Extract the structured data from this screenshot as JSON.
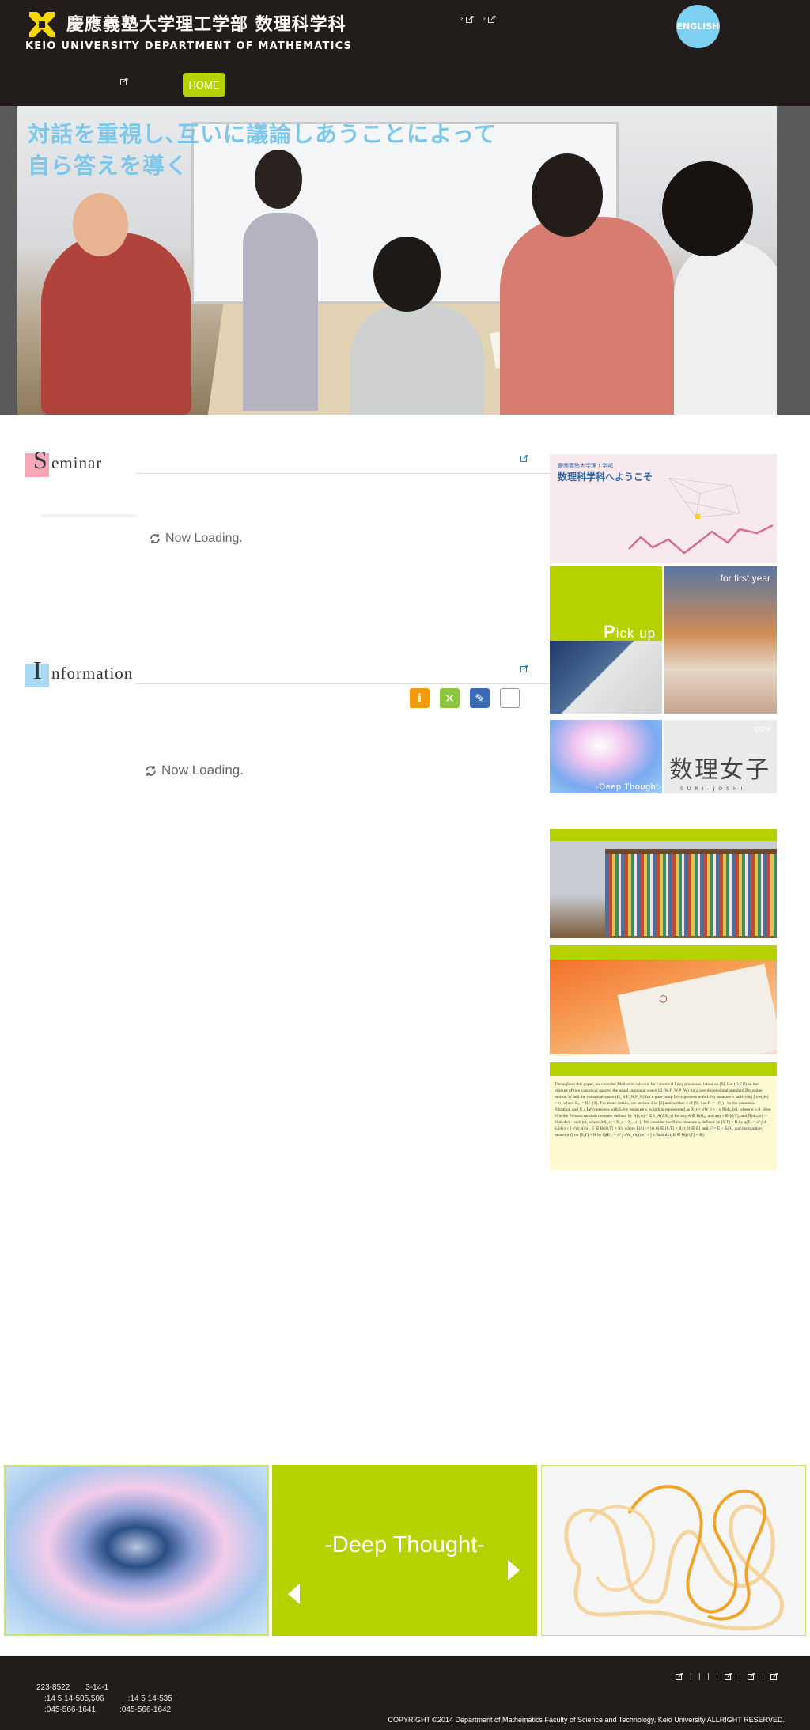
{
  "header": {
    "logo_jp": "慶應義塾大学理工学部 数理科学科",
    "logo_en": "KEIO UNIVERSITY  DEPARTMENT OF MATHEMATICS",
    "util_links": [
      "› ",
      "› "
    ],
    "english_label": "ENGLISH"
  },
  "nav": {
    "items": [
      "",
      ""
    ],
    "home_label": "HOME"
  },
  "hero": {
    "catch_line1": "対話を重視し､互いに議論しあうことによって",
    "catch_line2": "自ら答えを導く"
  },
  "seminar": {
    "initial": "S",
    "rest": "eminar",
    "loading": "Now Loading."
  },
  "information": {
    "initial": "I",
    "rest": "nformation",
    "loading": "Now Loading."
  },
  "banners": {
    "welcome_small": "慶應義塾大学理工学部",
    "welcome_title": "数理科学科へようこそ",
    "pickup_p": "P",
    "pickup_rest": "ick up",
    "first_year": "for first year",
    "deep_thought": "-Deep Thought-",
    "joshi_label": "oshi",
    "joshi_big": "数理女子",
    "joshi_sub": "SURI-JOSHI",
    "paper_text": "Throughout this paper, we consider Malliavin calculus for canonical Lévy processes, based on [9]. Let (Ω,F,P) be the product of two canonical spaces; the usual canonical space (Ω_W,F_W,P_W) for a one-dimensional standard Brownian motion W and the canonical space (Ω_N,F_N,P_N) for a pure-jump Lévy process with Lévy measure ν satisfying ∫ x²ν(dx) < ∞, where R₀ := R \\ {0}. For more details, see section 3 of [3] and section 4 of [9]. Let F := {F_t} be the canonical filtration, and X a Lévy process with Lévy measure ν, which is represented as X_t = σW_t + ∫ x Ñ(ds,dx), where σ ≥ 0. Here N is the Poisson random measure defined by N(t,A) = Σ 1_A(ΔX_s) for any A ∈ B(R₀) and any t ∈ [0,T], and Ñ(dt,dx) := N(dt,dx) − ν(dx)dt, where ΔX_s := X_s − X_{s−}. We consider the finite measure q defined on [0,T] × R by  q(E) = σ² ∫ dt δ₀(dx) + ∫ x²dt ν(dx),  E ∈ B([0,T] × R),  where E(0) := {(t,0) ∈ [0,T] × R:(t,0) ∈ E} and E' = E − E(0), and the random measure Q on [0,T] × R by  Q(E) := σ² ∫ dW_t δ₀(dx) + ∫ x Ñ(dt,dx),  E ∈ B([0,T] × R)."
  },
  "bottom": {
    "deep_title": "-Deep Thought-"
  },
  "footer": {
    "addr_line1": "223-8522　　3-14-1",
    "addr_line2": "　:14  5  14-505,506　　　:14  5  14-535",
    "addr_line3": "　:045-566-1641　　　:045-566-1642",
    "links": [
      "|",
      "|",
      "|",
      "|",
      "|",
      "|"
    ],
    "copyright": "COPYRIGHT ©2014 Department of Mathematics Faculty of Science and Technology, Keio University ALLRIGHT RESERVED."
  },
  "colors": {
    "dark": "#221c1a",
    "accent_green": "#b5d100",
    "accent_blue": "#7dd0f0",
    "seminar_pink": "#f6a8b8",
    "info_blue": "#a9d9f3"
  },
  "icons": [
    "keio-pen-logo-icon",
    "external-link-icon",
    "refresh-icon",
    "info-icon",
    "cross-icon",
    "pen-icon",
    "blank-icon",
    "arrow-left-icon",
    "arrow-right-icon"
  ]
}
